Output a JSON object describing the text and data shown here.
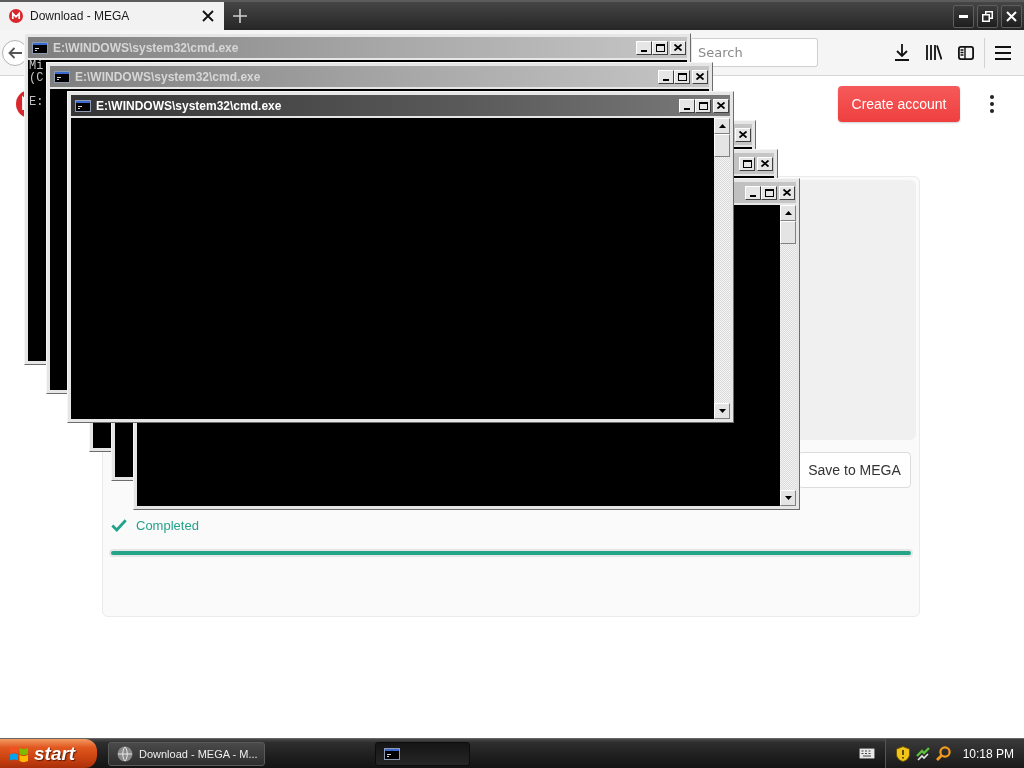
{
  "browser": {
    "tabs": [
      {
        "title": "Download - MEGA",
        "selected": true
      }
    ],
    "toolbar": {
      "search": {
        "placeholder": "Search"
      }
    },
    "page": {
      "header": {
        "button": "Create account"
      },
      "transfer": {
        "action": "Save to MEGA",
        "status": "Completed",
        "level": 1
      }
    }
  },
  "windows": [
    {
      "title": "E:\\WINDOWS\\system32\\cmd.exe",
      "active": false,
      "output": [
        [
          "Mi",
          "(C"
        ],
        [
          "E:"
        ]
      ]
    },
    {
      "title": "E:\\WINDOWS\\system32\\cmd.exe",
      "active": false
    },
    {
      "title": "E:\\WINDOWS\\system32\\cmd.exe",
      "active": true
    },
    {
      "active": false
    },
    {
      "active": false
    },
    {
      "active": false
    }
  ],
  "taskbar": {
    "start": "start",
    "tasks": [
      {
        "kind": "browser",
        "label": "Download - MEGA - M...",
        "selected": false
      },
      {
        "kind": "console",
        "selected": true
      }
    ],
    "clock": "10:18 PM"
  }
}
